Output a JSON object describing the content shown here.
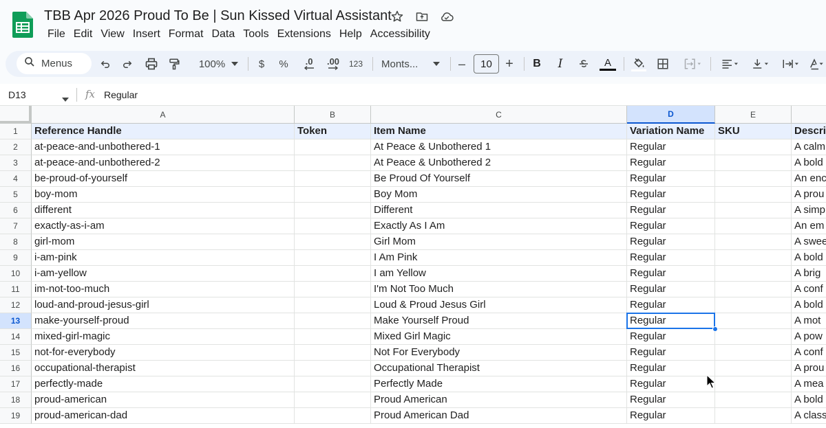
{
  "document": {
    "title": "TBB Apr 2026 Proud To Be | Sun Kissed Virtual Assistant"
  },
  "menu": [
    "File",
    "Edit",
    "View",
    "Insert",
    "Format",
    "Data",
    "Tools",
    "Extensions",
    "Help",
    "Accessibility"
  ],
  "toolbar": {
    "menus_label": "Menus",
    "zoom": "100%",
    "currency": "$",
    "percent": "%",
    "decrease_decimal": ".0",
    "increase_decimal": ".00",
    "number_format": "123",
    "font": "Monts...",
    "font_size": "10",
    "minus": "–",
    "plus": "+",
    "bold": "B",
    "italic": "I",
    "text_color_label": "A"
  },
  "formula_bar": {
    "cell_ref": "D13",
    "fx": "fx",
    "value": "Regular"
  },
  "columns": [
    "A",
    "B",
    "C",
    "D",
    "E",
    ""
  ],
  "selected_column": "D",
  "selected_row": "13",
  "header_row": {
    "row_number": "1",
    "cells": [
      "Reference Handle",
      "Token",
      "Item Name",
      "Variation Name",
      "SKU",
      "Descri"
    ]
  },
  "rows": [
    {
      "num": "2",
      "cells": [
        "at-peace-and-unbothered-1",
        "",
        "At Peace & Unbothered 1",
        "Regular",
        "",
        "A calm"
      ]
    },
    {
      "num": "3",
      "cells": [
        "at-peace-and-unbothered-2",
        "",
        "At Peace & Unbothered 2",
        "Regular",
        "",
        "A bold"
      ]
    },
    {
      "num": "4",
      "cells": [
        "be-proud-of-yourself",
        "",
        "Be Proud Of Yourself",
        "Regular",
        "",
        "An enc"
      ]
    },
    {
      "num": "5",
      "cells": [
        "boy-mom",
        "",
        "Boy Mom",
        "Regular",
        "",
        "A prou"
      ]
    },
    {
      "num": "6",
      "cells": [
        "different",
        "",
        "Different",
        "Regular",
        "",
        "A simp"
      ]
    },
    {
      "num": "7",
      "cells": [
        "exactly-as-i-am",
        "",
        "Exactly As I Am",
        "Regular",
        "",
        "An em"
      ]
    },
    {
      "num": "8",
      "cells": [
        "girl-mom",
        "",
        "Girl Mom",
        "Regular",
        "",
        "A swee"
      ]
    },
    {
      "num": "9",
      "cells": [
        "i-am-pink",
        "",
        "I Am Pink",
        "Regular",
        "",
        "A bold"
      ]
    },
    {
      "num": "10",
      "cells": [
        "i-am-yellow",
        "",
        "I am Yellow",
        "Regular",
        "",
        "A brig"
      ]
    },
    {
      "num": "11",
      "cells": [
        "im-not-too-much",
        "",
        "I'm Not Too Much",
        "Regular",
        "",
        "A conf"
      ]
    },
    {
      "num": "12",
      "cells": [
        "loud-and-proud-jesus-girl",
        "",
        "Loud & Proud Jesus Girl",
        "Regular",
        "",
        "A bold"
      ]
    },
    {
      "num": "13",
      "cells": [
        "make-yourself-proud",
        "",
        "Make Yourself Proud",
        "Regular",
        "",
        "A mot"
      ]
    },
    {
      "num": "14",
      "cells": [
        "mixed-girl-magic",
        "",
        "Mixed Girl Magic",
        "Regular",
        "",
        "A pow"
      ]
    },
    {
      "num": "15",
      "cells": [
        "not-for-everybody",
        "",
        "Not For Everybody",
        "Regular",
        "",
        "A conf"
      ]
    },
    {
      "num": "16",
      "cells": [
        "occupational-therapist",
        "",
        "Occupational Therapist",
        "Regular",
        "",
        "A prou"
      ]
    },
    {
      "num": "17",
      "cells": [
        "perfectly-made",
        "",
        "Perfectly Made",
        "Regular",
        "",
        "A mea"
      ]
    },
    {
      "num": "18",
      "cells": [
        "proud-american",
        "",
        "Proud American",
        "Regular",
        "",
        "A bold"
      ]
    },
    {
      "num": "19",
      "cells": [
        "proud-american-dad",
        "",
        "Proud American Dad",
        "Regular",
        "",
        "A class"
      ]
    }
  ],
  "icons": {
    "logo": "google-sheets-logo",
    "star": "star-icon",
    "move": "move-to-folder-icon",
    "cloud": "cloud-status-icon",
    "search": "search-icon"
  },
  "colors": {
    "accent": "#1a73e8",
    "sheets_green": "#0f9d58",
    "header_fill": "#e8f0fe"
  }
}
